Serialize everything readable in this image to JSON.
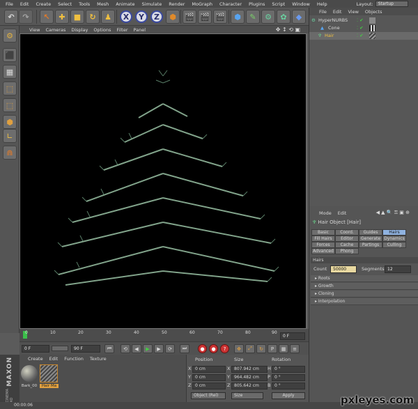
{
  "menu": [
    "File",
    "Edit",
    "Create",
    "Select",
    "Tools",
    "Mesh",
    "Animate",
    "Simulate",
    "Render",
    "MoGraph",
    "Character",
    "Plugins",
    "Script",
    "Window",
    "Help"
  ],
  "layout": {
    "label": "Layout:",
    "value": "Startup"
  },
  "axis_buttons": [
    "X",
    "Y",
    "Z"
  ],
  "viewport_menu": [
    "View",
    "Cameras",
    "Display",
    "Options",
    "Filter",
    "Panel"
  ],
  "timeline": {
    "ticks": [
      "0",
      "10",
      "20",
      "30",
      "40",
      "50",
      "60",
      "70",
      "80",
      "90"
    ],
    "end_label": "0 F"
  },
  "transport": {
    "current": "0 F",
    "start": "0 F",
    "end": "90 F"
  },
  "materials": {
    "menu": [
      "Create",
      "Edit",
      "Function",
      "Texture"
    ],
    "items": [
      {
        "name": "Bark_00"
      },
      {
        "name": "Hair Ma"
      }
    ]
  },
  "coordinates": {
    "headers": [
      "Position",
      "Size",
      "Rotation"
    ],
    "rows": [
      {
        "axis": "X",
        "pos": "0 cm",
        "size_axis": "X",
        "size": "807.942 cm",
        "rot_axis": "H",
        "rot": "0 °"
      },
      {
        "axis": "Y",
        "pos": "0 cm",
        "size_axis": "Y",
        "size": "964.482 cm",
        "rot_axis": "P",
        "rot": "0 °"
      },
      {
        "axis": "Z",
        "pos": "0 cm",
        "size_axis": "Z",
        "size": "805.642 cm",
        "rot_axis": "B",
        "rot": "0 °"
      }
    ],
    "mode": "Object (Rel)",
    "size_mode": "Size",
    "apply": "Apply"
  },
  "objects": {
    "menu": [
      "File",
      "Edit",
      "View",
      "Objects"
    ],
    "items": [
      {
        "name": "HyperNURBS"
      },
      {
        "name": "Cone"
      },
      {
        "name": "Hair"
      }
    ]
  },
  "attributes": {
    "menu": [
      "Mode",
      "Edit"
    ],
    "title": "Hair Object [Hair]",
    "tabs": [
      "Basic",
      "Coord.",
      "Guides",
      "Hairs",
      "Fill Hairs",
      "Editor",
      "Generate",
      "Dynamics",
      "Forces",
      "Cache",
      "Partings",
      "Culling",
      "Advanced",
      "Phong"
    ],
    "active_tab": "Hairs",
    "section": "Hairs",
    "count_label": "Count",
    "count": "50000",
    "segments_label": "Segments",
    "segments": "12",
    "groups": [
      "Roots",
      "Growth",
      "Cloning",
      "Interpolation"
    ]
  },
  "maxon": {
    "brand": "MAXON",
    "product": "CINEMA 4D"
  },
  "status": "00:00:06",
  "watermark": "pxleyes.com"
}
